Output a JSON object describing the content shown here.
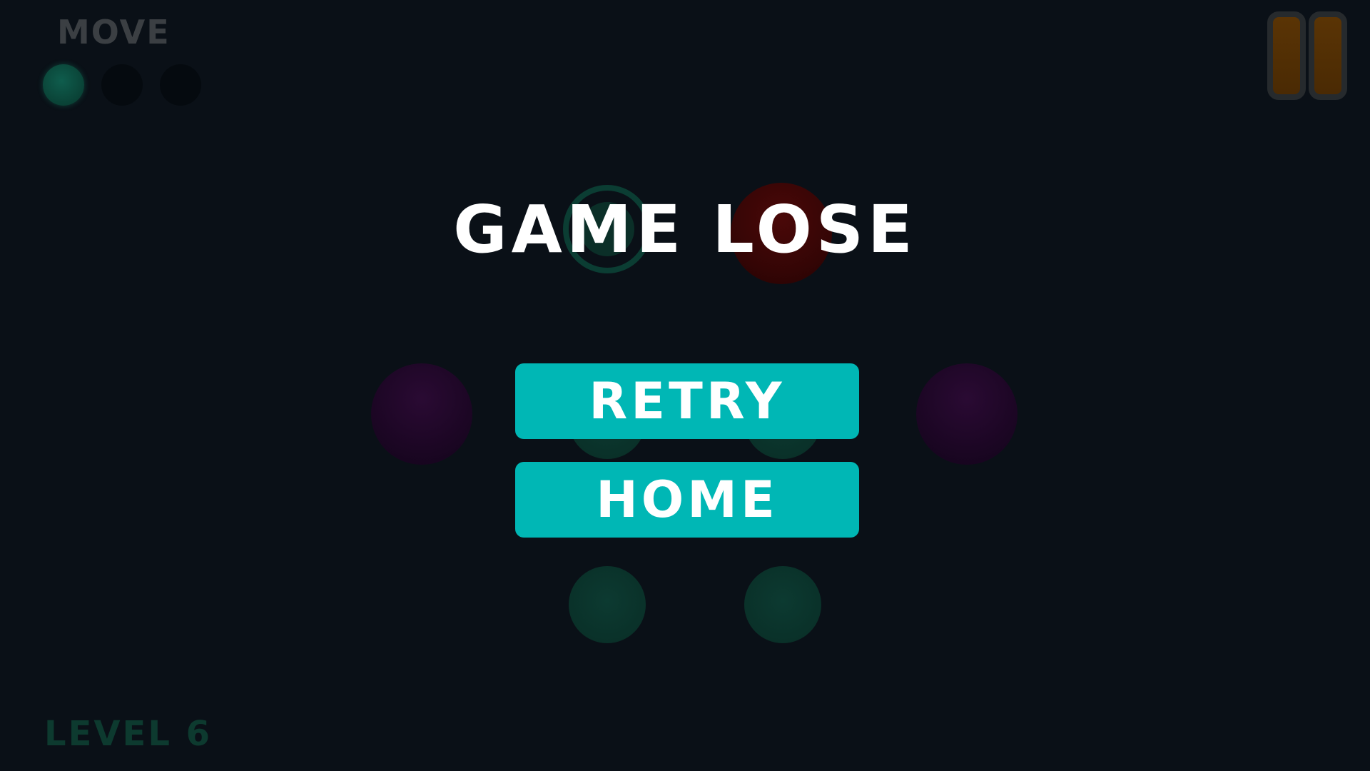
{
  "hud": {
    "move_label": "MOVE",
    "moves_total": 3,
    "moves_used": 1,
    "level_label": "LEVEL 6"
  },
  "colors": {
    "background": "#0a1017",
    "button": "#00b7b5",
    "button_text": "#ffffff",
    "title_text": "#ffffff",
    "pause_fill": "#5a3405"
  },
  "icons": {
    "pause": "pause-icon"
  },
  "board": {
    "nodes": [
      {
        "kind": "target"
      },
      {
        "kind": "red"
      },
      {
        "kind": "purple"
      },
      {
        "kind": "green"
      },
      {
        "kind": "green"
      },
      {
        "kind": "purple"
      },
      {
        "kind": "green"
      },
      {
        "kind": "green"
      }
    ]
  },
  "dialog": {
    "title": "GAME LOSE",
    "retry_label": "RETRY",
    "home_label": "HOME"
  }
}
